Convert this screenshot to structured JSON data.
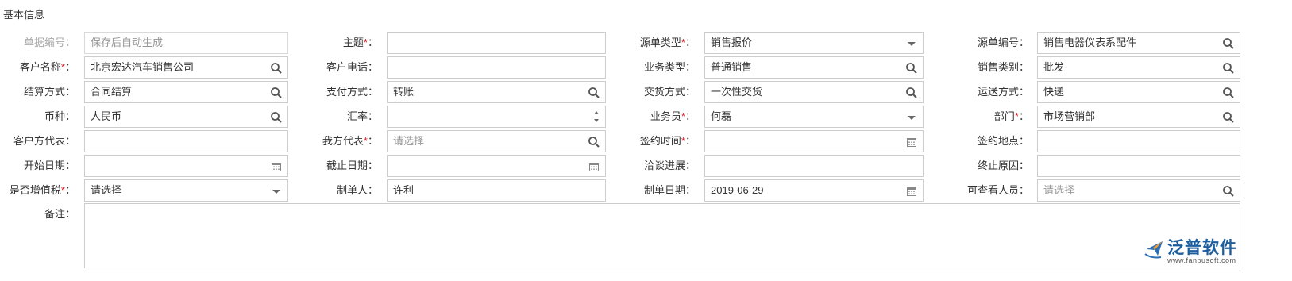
{
  "section": {
    "title": "基本信息"
  },
  "rows": [
    [
      {
        "label": "单据编号",
        "required": false,
        "disabled": true,
        "value": "",
        "placeholder": "保存后自动生成",
        "icon": ""
      },
      {
        "label": "主题",
        "required": true,
        "disabled": false,
        "value": "",
        "placeholder": "",
        "icon": ""
      },
      {
        "label": "源单类型",
        "required": true,
        "disabled": false,
        "value": "销售报价",
        "placeholder": "",
        "icon": "dropdown"
      },
      {
        "label": "源单编号",
        "required": false,
        "disabled": false,
        "value": "销售电器仪表系配件",
        "placeholder": "",
        "icon": "search"
      }
    ],
    [
      {
        "label": "客户名称",
        "required": true,
        "disabled": false,
        "value": "北京宏达汽车销售公司",
        "placeholder": "",
        "icon": "search"
      },
      {
        "label": "客户电话",
        "required": false,
        "disabled": false,
        "value": "",
        "placeholder": "",
        "icon": ""
      },
      {
        "label": "业务类型",
        "required": false,
        "disabled": false,
        "value": "普通销售",
        "placeholder": "",
        "icon": "search"
      },
      {
        "label": "销售类别",
        "required": false,
        "disabled": false,
        "value": "批发",
        "placeholder": "",
        "icon": "search"
      }
    ],
    [
      {
        "label": "结算方式",
        "required": false,
        "disabled": false,
        "value": "合同结算",
        "placeholder": "",
        "icon": "search"
      },
      {
        "label": "支付方式",
        "required": false,
        "disabled": false,
        "value": "转账",
        "placeholder": "",
        "icon": "search"
      },
      {
        "label": "交货方式",
        "required": false,
        "disabled": false,
        "value": "一次性交货",
        "placeholder": "",
        "icon": "search"
      },
      {
        "label": "运送方式",
        "required": false,
        "disabled": false,
        "value": "快递",
        "placeholder": "",
        "icon": "search"
      }
    ],
    [
      {
        "label": "币种",
        "required": false,
        "disabled": false,
        "value": "人民币",
        "placeholder": "",
        "icon": "search"
      },
      {
        "label": "汇率",
        "required": false,
        "disabled": false,
        "value": "",
        "placeholder": "",
        "icon": "spinner"
      },
      {
        "label": "业务员",
        "required": true,
        "disabled": false,
        "value": "何磊",
        "placeholder": "",
        "icon": "dropdown"
      },
      {
        "label": "部门",
        "required": true,
        "disabled": false,
        "value": "市场营销部",
        "placeholder": "",
        "icon": "search"
      }
    ],
    [
      {
        "label": "客户方代表",
        "required": false,
        "disabled": false,
        "value": "",
        "placeholder": "",
        "icon": ""
      },
      {
        "label": "我方代表",
        "required": true,
        "disabled": false,
        "value": "",
        "placeholder": "请选择",
        "icon": "search"
      },
      {
        "label": "签约时间",
        "required": true,
        "disabled": false,
        "value": "",
        "placeholder": "",
        "icon": "calendar"
      },
      {
        "label": "签约地点",
        "required": false,
        "disabled": false,
        "value": "",
        "placeholder": "",
        "icon": ""
      }
    ],
    [
      {
        "label": "开始日期",
        "required": false,
        "disabled": false,
        "value": "",
        "placeholder": "",
        "icon": "calendar"
      },
      {
        "label": "截止日期",
        "required": false,
        "disabled": false,
        "value": "",
        "placeholder": "",
        "icon": "calendar"
      },
      {
        "label": "洽谈进展",
        "required": false,
        "disabled": false,
        "value": "",
        "placeholder": "",
        "icon": ""
      },
      {
        "label": "终止原因",
        "required": false,
        "disabled": false,
        "value": "",
        "placeholder": "",
        "icon": ""
      }
    ],
    [
      {
        "label": "是否增值税",
        "required": true,
        "disabled": false,
        "value": "请选择",
        "placeholder": "",
        "icon": "dropdown"
      },
      {
        "label": "制单人",
        "required": false,
        "disabled": false,
        "value": "许利",
        "placeholder": "",
        "icon": ""
      },
      {
        "label": "制单日期",
        "required": false,
        "disabled": false,
        "value": "2019-06-29",
        "placeholder": "",
        "icon": "calendar"
      },
      {
        "label": "可查看人员",
        "required": false,
        "disabled": false,
        "value": "",
        "placeholder": "请选择",
        "icon": "search"
      }
    ]
  ],
  "notes": {
    "label": "备注",
    "value": ""
  },
  "watermark": {
    "brand": "泛普软件",
    "url": "www.fanpusoft.com"
  },
  "colors": {
    "required": "#e02020",
    "border": "#cccccc",
    "placeholder": "#999999",
    "brand": "#1d5f9e"
  }
}
